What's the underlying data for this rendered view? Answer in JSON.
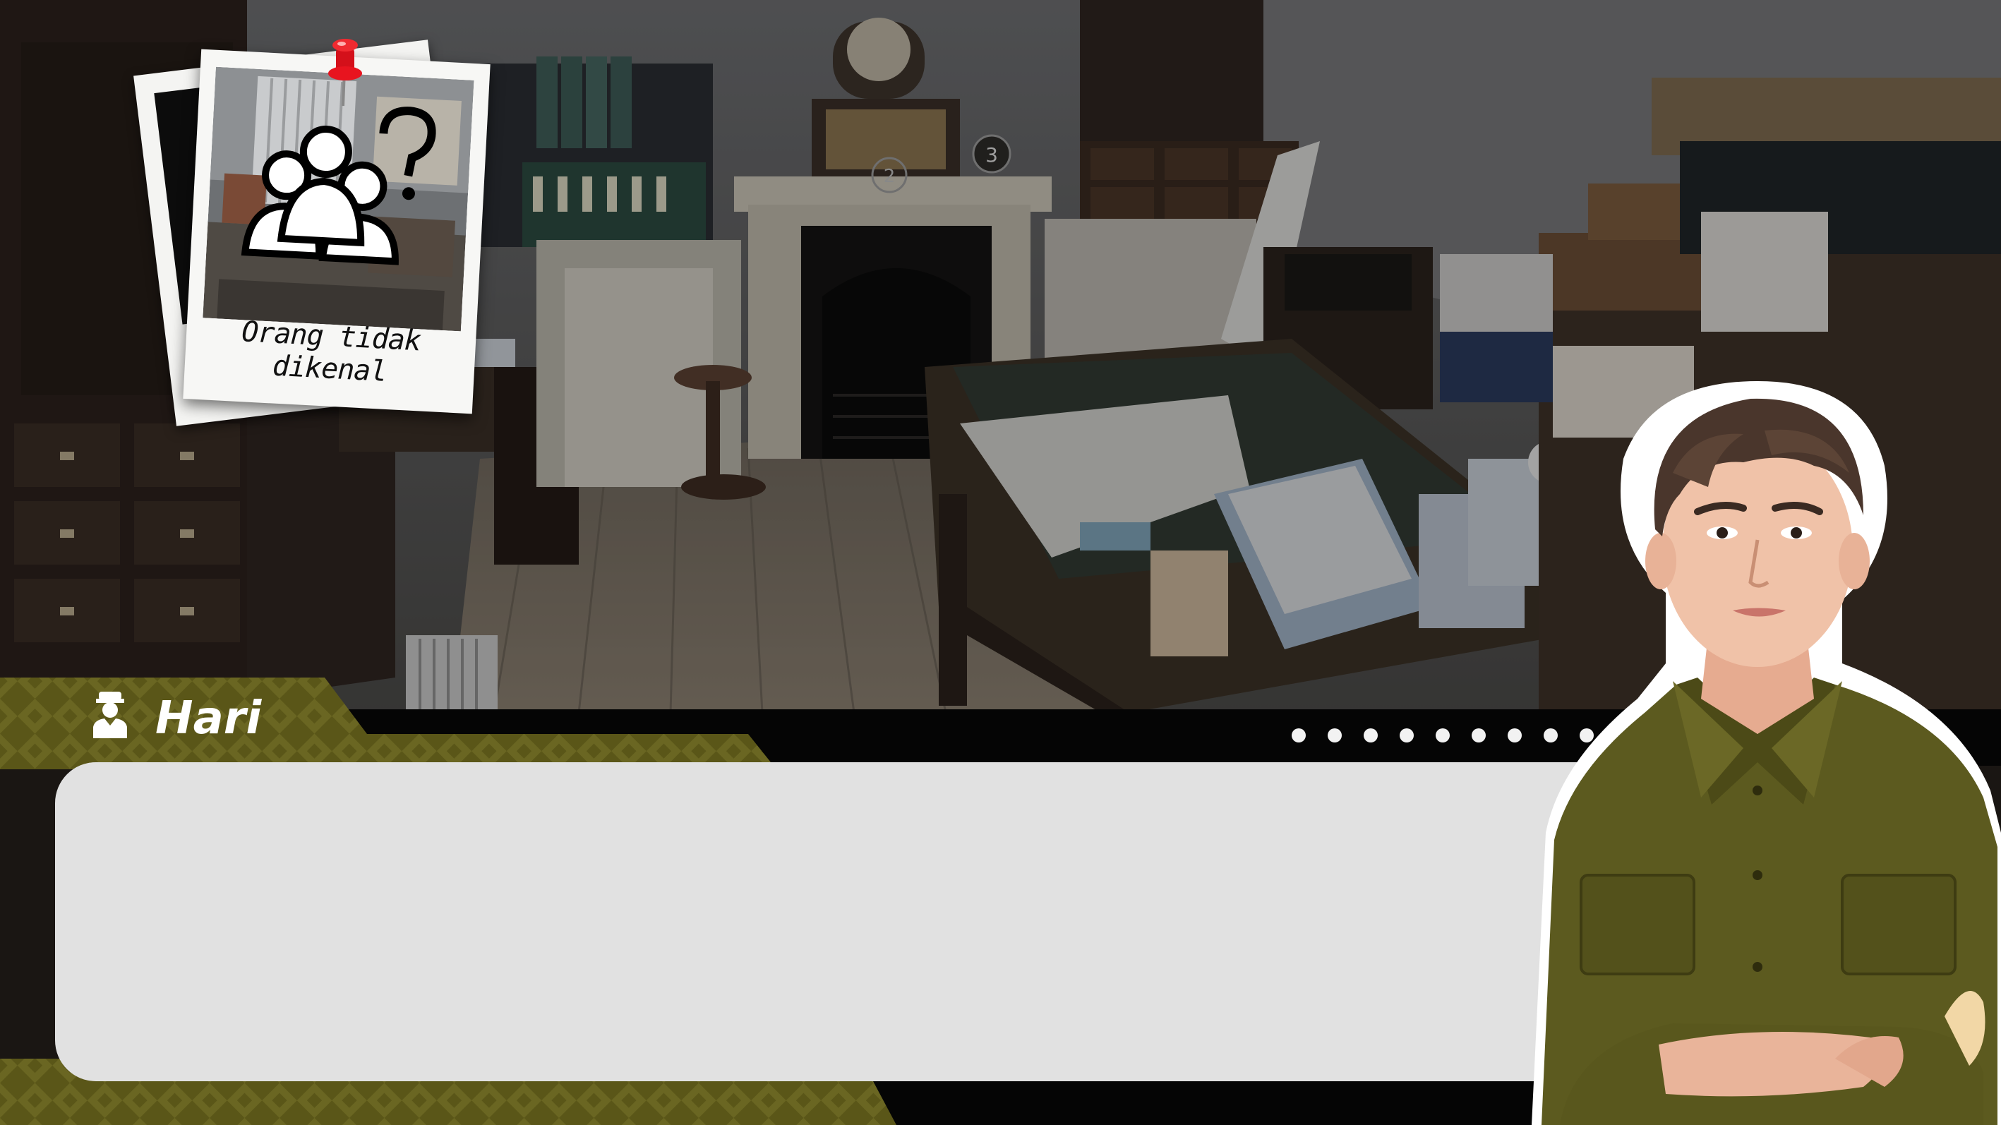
{
  "scene": {
    "name": "study-room-background",
    "markers": [
      "2",
      "3"
    ]
  },
  "evidence_card": {
    "caption": "Orang tidak dikenal",
    "icon": "unknown-people-icon"
  },
  "dialogue": {
    "speaker_name": "Hari",
    "speaker_icon": "soldier-icon",
    "text": "",
    "progress_dots": 9
  },
  "character": {
    "name": "Hari",
    "outfit_color": "#5a5a1e"
  },
  "colors": {
    "name_tab": "#5a5618",
    "name_tab_pattern": "#6d6a24",
    "dialogue_box": "#e1e1e1",
    "bottom_bar": "#050505"
  }
}
